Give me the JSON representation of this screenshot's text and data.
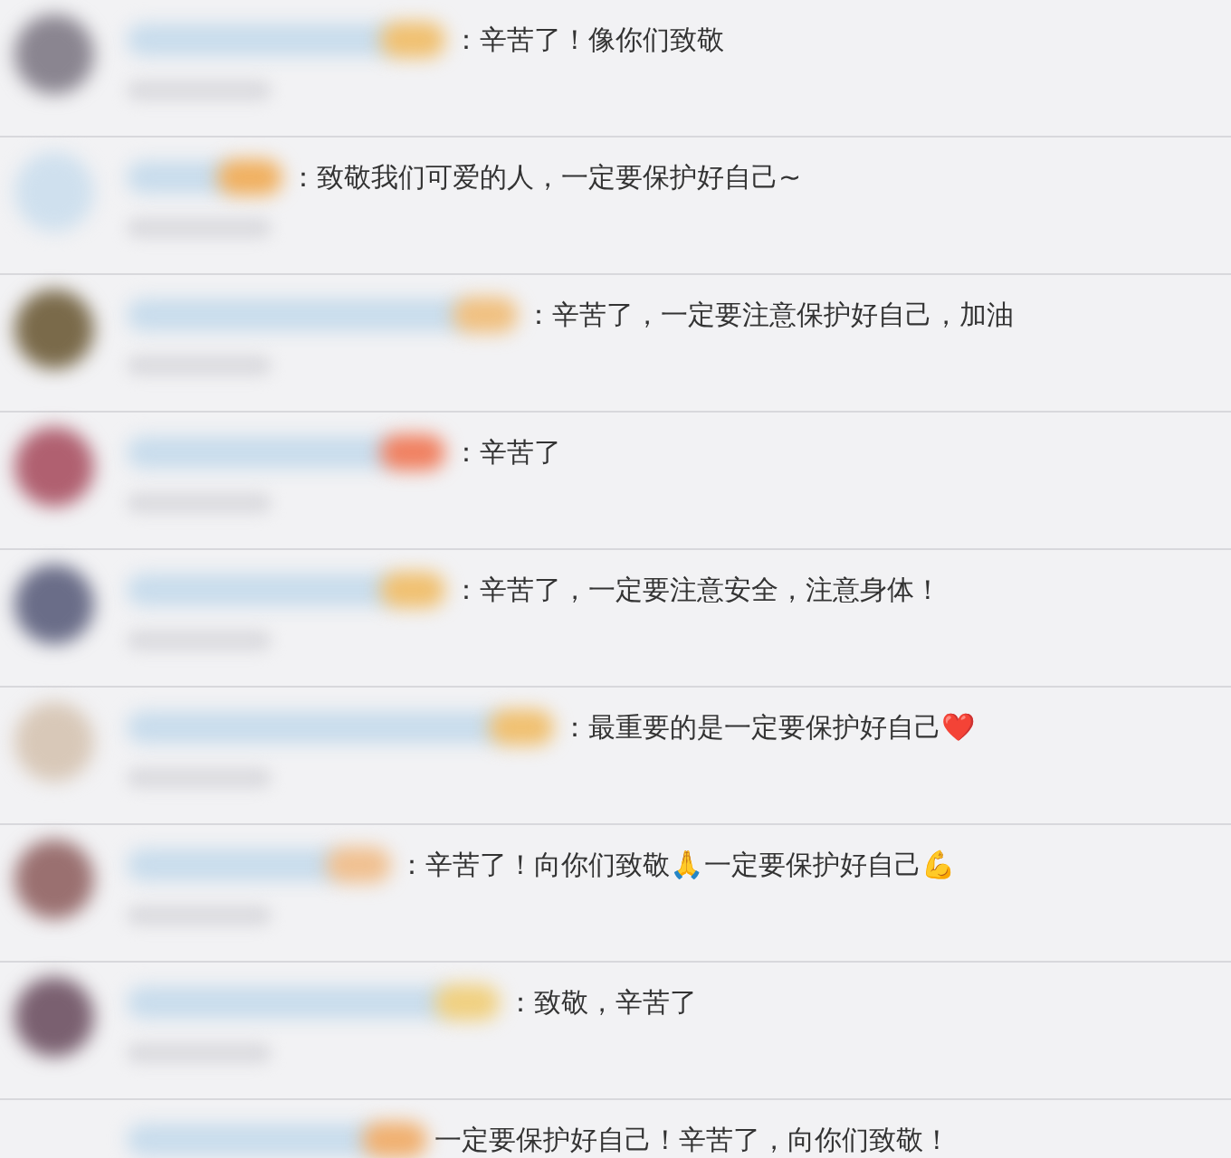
{
  "comments": [
    {
      "text": "：辛苦了！像你们致敬"
    },
    {
      "text": "：致敬我们可爱的人，一定要保护好自己~"
    },
    {
      "text": "：辛苦了，一定要注意保护好自己，加油"
    },
    {
      "text": "：辛苦了"
    },
    {
      "text": "：辛苦了，一定要注意安全，注意身体！"
    },
    {
      "text": "：最重要的是一定要保护好自己❤️"
    },
    {
      "text": "：辛苦了！向你们致敬🙏一定要保护好自己💪"
    },
    {
      "text": "：致敬，辛苦了"
    },
    {
      "text": "一定要保护好自己！辛苦了，向你们致敬！"
    }
  ]
}
